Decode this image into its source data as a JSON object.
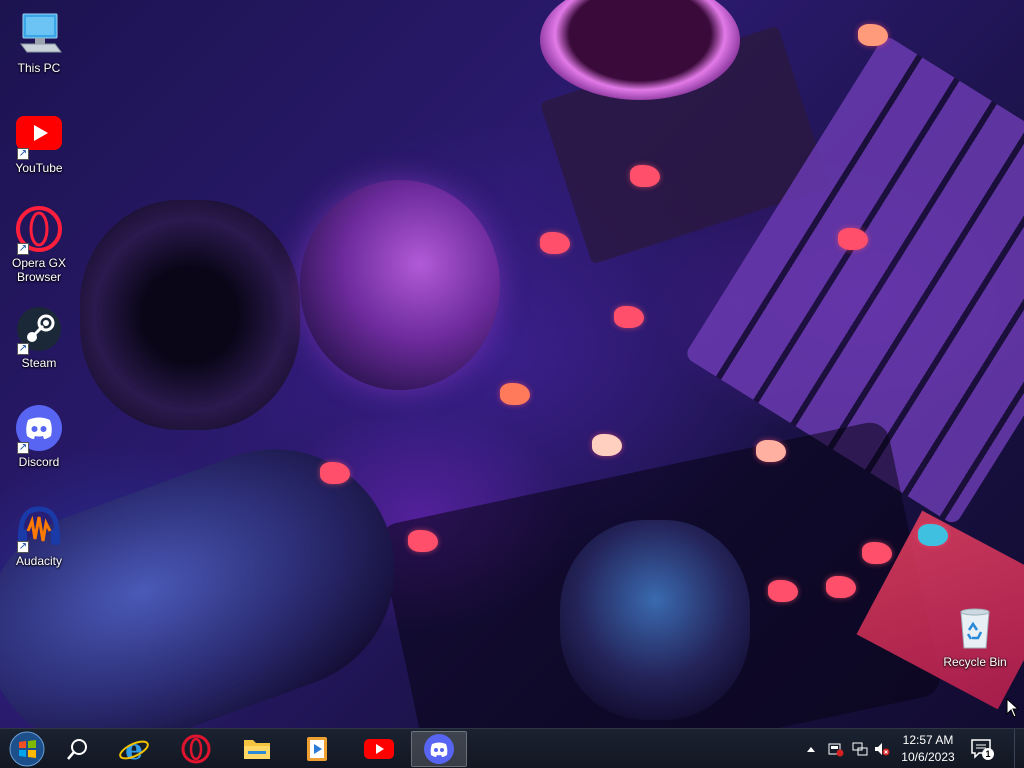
{
  "desktop": {
    "icons": [
      {
        "label": "This PC",
        "icon": "computer-icon"
      },
      {
        "label": "YouTube",
        "icon": "youtube-icon"
      },
      {
        "label": "Opera GX Browser",
        "icon": "opera-gx-icon"
      },
      {
        "label": "Steam",
        "icon": "steam-icon"
      },
      {
        "label": "Discord",
        "icon": "discord-icon"
      },
      {
        "label": "Audacity",
        "icon": "audacity-icon"
      },
      {
        "label": "Recycle Bin",
        "icon": "recycle-bin-icon"
      }
    ]
  },
  "taskbar": {
    "pinned": [
      {
        "name": "start-button",
        "icon": "windows-start-icon"
      },
      {
        "name": "search-button",
        "icon": "search-icon"
      },
      {
        "name": "internet-explorer",
        "icon": "internet-explorer-icon"
      },
      {
        "name": "opera",
        "icon": "opera-icon"
      },
      {
        "name": "file-explorer",
        "icon": "folder-icon"
      },
      {
        "name": "media-player",
        "icon": "media-player-icon"
      },
      {
        "name": "youtube",
        "icon": "youtube-icon"
      },
      {
        "name": "discord",
        "icon": "discord-icon",
        "active": true
      }
    ],
    "clock": {
      "time": "12:57 AM",
      "date": "10/6/2023"
    },
    "notification_count": "1"
  },
  "colors": {
    "youtube_red": "#ff0000",
    "opera_red": "#e0142f",
    "discord_blurple": "#5865f2",
    "taskbar": "#151b27"
  }
}
